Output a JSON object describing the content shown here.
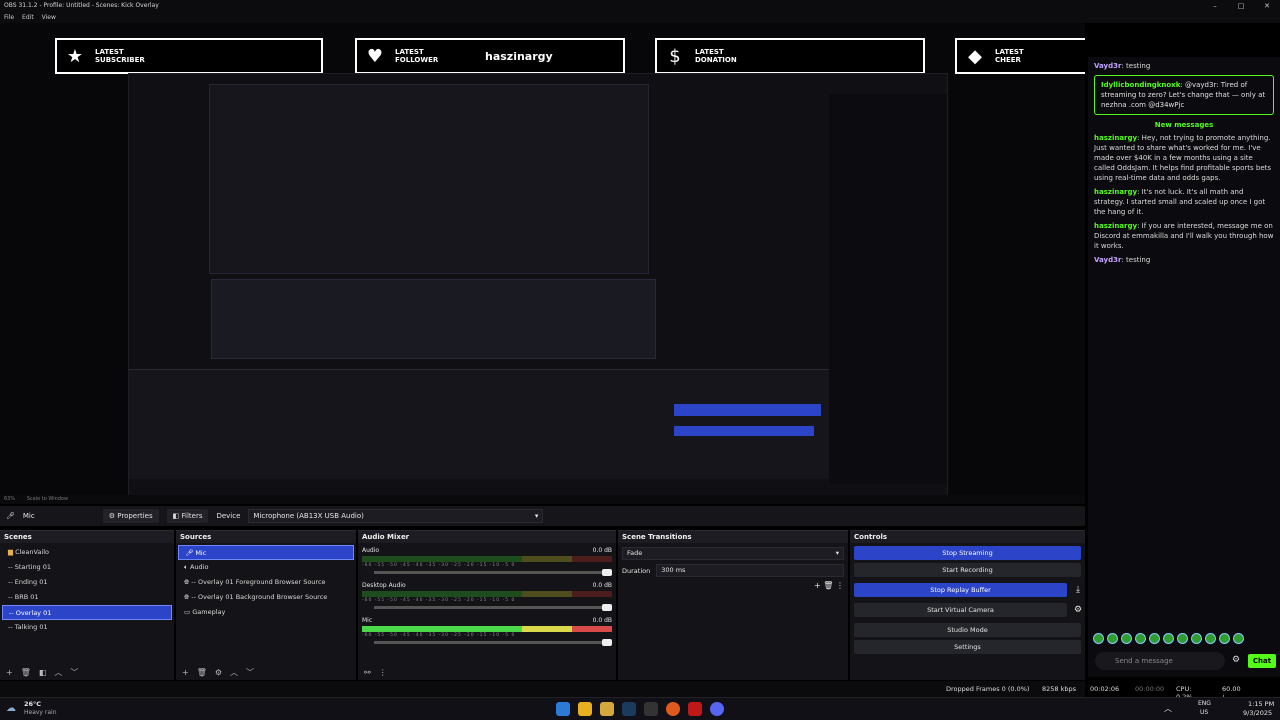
{
  "window": {
    "title": "OBS 31.1.2 - Profile: Untitled - Scenes: Kick Overlay",
    "controls": [
      "–",
      "□",
      "✕"
    ]
  },
  "menu": [
    "File",
    "Edit",
    "View"
  ],
  "alerts": [
    {
      "label": "LATEST\nSUBSCRIBER",
      "name": "",
      "icon": "star-icon"
    },
    {
      "label": "LATEST\nFOLLOWER",
      "name": "haszinargy",
      "icon": "heart-icon"
    },
    {
      "label": "LATEST\nDONATION",
      "name": "",
      "icon": "dollar-icon"
    },
    {
      "label": "LATEST\nCHEER",
      "name": "",
      "icon": "diamond-icon"
    }
  ],
  "chat": {
    "system_user": "Idyllicbondingknoxk",
    "system_text": ": @vayd3r: Tired of streaming to zero? Let's change that — only at nezhna .com @d34wPjc",
    "new_messages": "New messages",
    "top_user": "Vayd3r",
    "top_text": ": testing",
    "messages": [
      {
        "user": "haszinargy",
        "text": ": Hey, not trying to promote anything. Just wanted to share what's worked for me. I've made over $40K in a few months using a site called OddsJam. It helps find profitable sports bets using real-time data and odds gaps."
      },
      {
        "user": "haszinargy",
        "text": ": It's not luck. It's all math and strategy. I started small and scaled up once I got the hang of it."
      },
      {
        "user": "haszinargy",
        "text": ": If you are interested, message me on Discord at emmakilla and I'll walk you through how it works."
      },
      {
        "user": "Vayd3r",
        "text": ": testing"
      }
    ],
    "input_placeholder": "Send a message",
    "chat_button": "Chat"
  },
  "zoom": {
    "percent": "63%",
    "mode": "Scale to Window"
  },
  "props": {
    "source": "Mic",
    "properties": "Properties",
    "filters": "Filters",
    "device_label": "Device",
    "device_value": "Microphone (AB13X USB Audio)"
  },
  "scenes": {
    "title": "Scenes",
    "items": [
      "CleanVailo",
      "-- Starting 01",
      "-- Ending 01",
      "-- BRB 01",
      "-- Overlay 01",
      "-- Talking 01"
    ],
    "selected": 4
  },
  "sources": {
    "title": "Sources",
    "items": [
      "Mic",
      "Audio",
      "-- Overlay 01 Foreground Browser Source",
      "-- Overlay 01 Background Browser Source",
      "Gameplay"
    ],
    "selected": 0
  },
  "mixer": {
    "title": "Audio Mixer",
    "channels": [
      {
        "name": "Desktop Audio",
        "db": "0.0 dB",
        "scale": "-60 -55 -50 -45 -40 -35 -30 -25 -20 -15 -10 -5 0",
        "active": false,
        "label": "Audio"
      },
      {
        "name": "Desktop Audio",
        "db": "0.0 dB",
        "scale": "-60 -55 -50 -45 -40 -35 -30 -25 -20 -15 -10 -5 0",
        "active": false,
        "label": "Desktop Audio"
      },
      {
        "name": "Mic",
        "db": "0.0 dB",
        "scale": "-60 -55 -50 -45 -40 -35 -30 -25 -20 -15 -10 -5 0",
        "active": true,
        "label": "Mic"
      }
    ]
  },
  "transitions": {
    "title": "Scene Transitions",
    "type": "Fade",
    "duration_label": "Duration",
    "duration": "300 ms"
  },
  "controls": {
    "title": "Controls",
    "buttons": [
      "Stop Streaming",
      "Start Recording",
      "Stop Replay Buffer",
      "Start Virtual Camera",
      "Studio Mode",
      "Settings"
    ]
  },
  "status": {
    "dropped": "Dropped Frames 0 (0.0%)",
    "bitrate": "8258 kbps",
    "live_time": "00:02:06",
    "rec_time": "00:00:00",
    "cpu": "CPU: 0.2%",
    "fps": "60.00 / 60.00 FPS"
  },
  "taskbar": {
    "weather_temp": "26°C",
    "weather_text": "Heavy rain",
    "lang": "ENG",
    "region": "US",
    "time": "1:15 PM",
    "date": "9/3/2025"
  },
  "colors": {
    "accent": "#2c44c8",
    "kick_green": "#53fc18"
  }
}
